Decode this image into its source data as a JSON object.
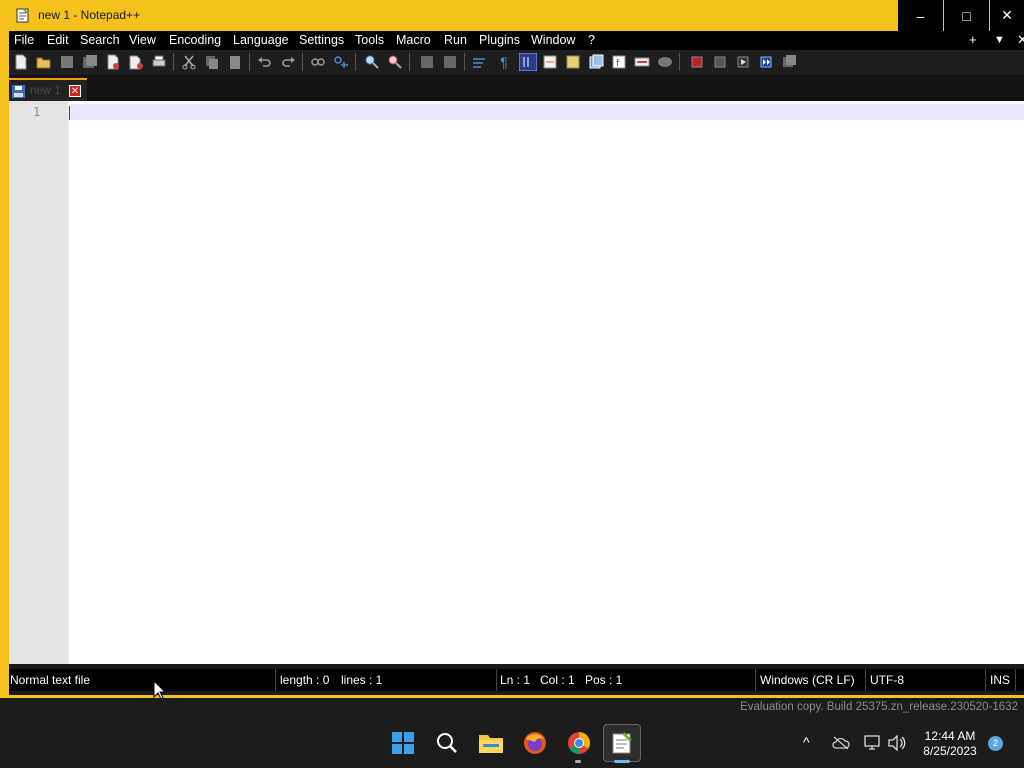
{
  "window": {
    "title": "new 1 - Notepad++",
    "controls": {
      "minimize": "–",
      "maximize": "□",
      "close": "✕"
    }
  },
  "menu": {
    "items": [
      "File",
      "Edit",
      "Search",
      "View",
      "Encoding",
      "Language",
      "Settings",
      "Tools",
      "Macro",
      "Run",
      "Plugins",
      "Window",
      "?"
    ],
    "right": {
      "add": "+",
      "dropdown": "▼",
      "close": "✕"
    }
  },
  "toolbar": {
    "icons": [
      "new-file-icon",
      "open-file-icon",
      "save-icon",
      "save-all-icon",
      "close-icon",
      "close-all-icon",
      "print-icon",
      "cut-icon",
      "copy-icon",
      "paste-icon",
      "undo-icon",
      "redo-icon",
      "find-icon",
      "replace-icon",
      "zoom-in-icon",
      "zoom-out-icon",
      "sync-vertical-icon",
      "sync-horizontal-icon",
      "word-wrap-icon",
      "show-all-characters-icon",
      "indent-guide-icon",
      "document-map-icon",
      "function-list-icon",
      "folder-workspace-icon",
      "user-defined-language-icon",
      "monitoring-icon",
      "macro-record-icon",
      "macro-stop-icon",
      "macro-play-icon",
      "macro-run-multiple-icon",
      "macro-save-icon"
    ]
  },
  "tab": {
    "label": "new 1",
    "close": "✕"
  },
  "editor": {
    "line_numbers": [
      "1"
    ],
    "content": ""
  },
  "status": {
    "file_type": "Normal text file",
    "length": "length : 0",
    "lines": "lines : 1",
    "ln": "Ln : 1",
    "col": "Col : 1",
    "pos": "Pos : 1",
    "eol": "Windows (CR LF)",
    "encoding": "UTF-8",
    "mode": "INS"
  },
  "evaluation": "Evaluation copy. Build 25375.zn_release.230520-1632",
  "taskbar": {
    "apps": [
      "start-icon",
      "search-icon",
      "file-explorer-icon",
      "firefox-icon",
      "chrome-icon",
      "notepad-plus-plus-icon"
    ],
    "tray": {
      "chevron": "^"
    },
    "time": "12:44 AM",
    "date": "8/25/2023",
    "notifications": "2"
  },
  "colors": {
    "accent": "#f4c21c",
    "caret": "#8000ff",
    "tab_border": "#f4a000"
  }
}
